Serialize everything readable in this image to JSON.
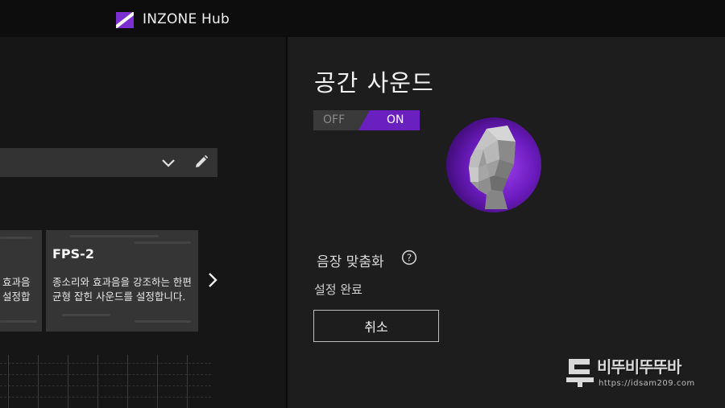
{
  "app": {
    "title": "INZONE Hub",
    "logo": "inzone-logo",
    "accent": "#6a1fbf"
  },
  "left": {
    "preset_card_partial": {
      "desc_line1": "효과음",
      "desc_line2": "설정합"
    },
    "preset_card": {
      "title": "FPS-2",
      "desc": "종소리와 효과음을 강조하는 한편 균형 잡힌 사운드를 설정합니다."
    },
    "icons": {
      "dropdown": "chevron-down-icon",
      "edit": "pencil-icon",
      "next": "chevron-right-icon"
    }
  },
  "spatial": {
    "title": "공간 사운드",
    "toggle": {
      "off_label": "OFF",
      "on_label": "ON",
      "state": "ON"
    },
    "eq_label": "음장 맞춤화",
    "help_icon": "question-circle-icon",
    "status": "설정 완료",
    "cancel_label": "취소"
  },
  "watermark": {
    "text": "비뚜비뚜뚜바",
    "url": "https://idsam209.com"
  }
}
